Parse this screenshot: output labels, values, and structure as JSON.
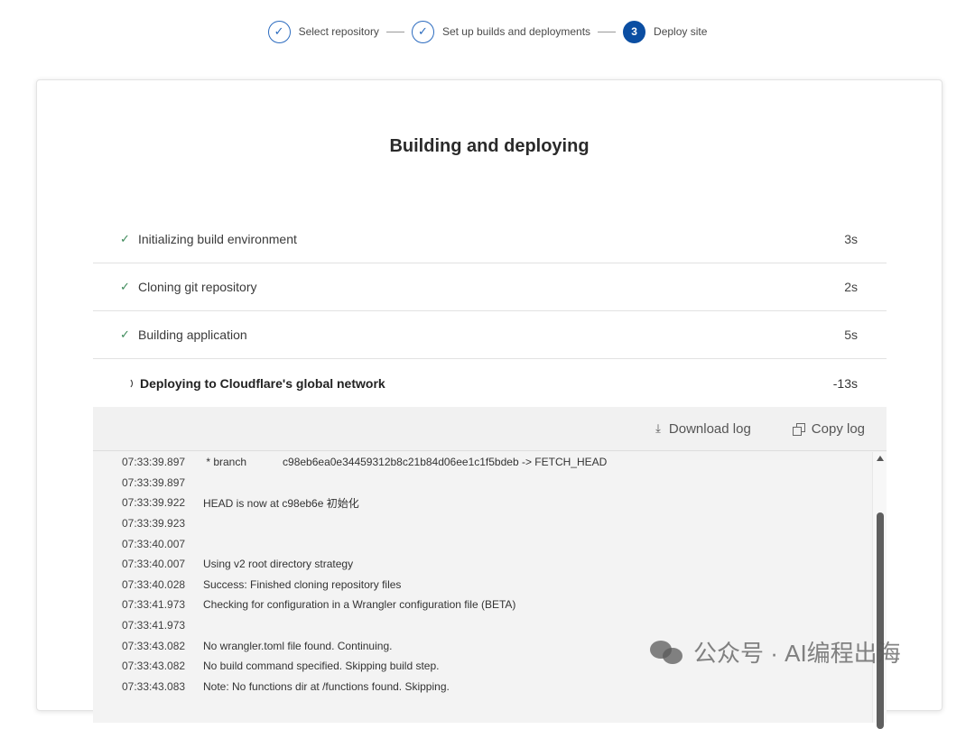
{
  "stepper": {
    "steps": [
      {
        "label": "Select repository",
        "status": "done",
        "marker": "✓"
      },
      {
        "label": "Set up builds and deployments",
        "status": "done",
        "marker": "✓"
      },
      {
        "label": "Deploy site",
        "status": "active",
        "marker": "3"
      }
    ]
  },
  "card": {
    "title": "Building and deploying"
  },
  "build_steps": [
    {
      "label": "Initializing build environment",
      "time": "3s",
      "status": "done"
    },
    {
      "label": "Cloning git repository",
      "time": "2s",
      "status": "done"
    },
    {
      "label": "Building application",
      "time": "5s",
      "status": "done"
    },
    {
      "label": "Deploying to Cloudflare's global network",
      "time": "-13s",
      "status": "in-progress"
    }
  ],
  "log_toolbar": {
    "download_label": "Download log",
    "copy_label": "Copy log",
    "download_icon": "download-icon",
    "copy_icon": "copy-icon"
  },
  "log_lines": [
    {
      "time": "07:33:39.897",
      "msg": " * branch            c98eb6ea0e34459312b8c21b84d06ee1c1f5bdeb -> FETCH_HEAD"
    },
    {
      "time": "07:33:39.897",
      "msg": ""
    },
    {
      "time": "07:33:39.922",
      "msg": "HEAD is now at c98eb6e 初始化"
    },
    {
      "time": "07:33:39.923",
      "msg": ""
    },
    {
      "time": "07:33:40.007",
      "msg": ""
    },
    {
      "time": "07:33:40.007",
      "msg": "Using v2 root directory strategy"
    },
    {
      "time": "07:33:40.028",
      "msg": "Success: Finished cloning repository files"
    },
    {
      "time": "07:33:41.973",
      "msg": "Checking for configuration in a Wrangler configuration file (BETA)"
    },
    {
      "time": "07:33:41.973",
      "msg": ""
    },
    {
      "time": "07:33:43.082",
      "msg": "No wrangler.toml file found. Continuing."
    },
    {
      "time": "07:33:43.082",
      "msg": "No build command specified. Skipping build step."
    },
    {
      "time": "07:33:43.083",
      "msg": "Note: No functions dir at /functions found. Skipping."
    }
  ],
  "watermark": {
    "text": "公众号 · AI编程出海"
  },
  "colors": {
    "accent": "#0b4ea2",
    "check": "#3d8a5a",
    "log_bg": "#f1f1f1"
  }
}
